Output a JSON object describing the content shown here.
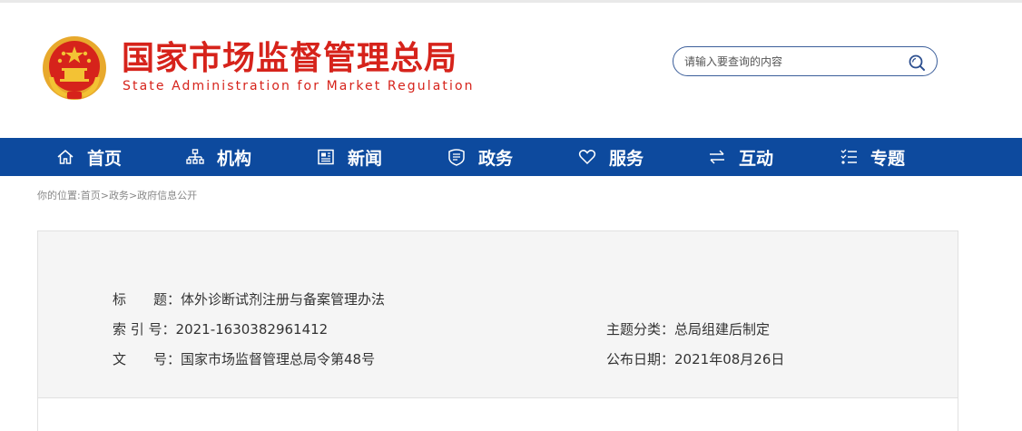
{
  "header": {
    "title_cn": "国家市场监督管理总局",
    "title_en": "State Administration for Market Regulation",
    "emblem_icon": "national-emblem-icon"
  },
  "search": {
    "placeholder": "请输入要查询的内容",
    "icon": "search-icon"
  },
  "nav": {
    "items": [
      {
        "label": "首页",
        "icon": "home-icon"
      },
      {
        "label": "机构",
        "icon": "org-chart-icon"
      },
      {
        "label": "新闻",
        "icon": "newspaper-icon"
      },
      {
        "label": "政务",
        "icon": "shield-book-icon"
      },
      {
        "label": "服务",
        "icon": "heart-icon"
      },
      {
        "label": "互动",
        "icon": "arrows-exchange-icon"
      },
      {
        "label": "专题",
        "icon": "list-icon"
      }
    ]
  },
  "breadcrumb": {
    "prefix": "你的位置:",
    "items": [
      "首页",
      "政务",
      "政府信息公开"
    ],
    "separator": ">"
  },
  "info": {
    "title_label": "标　　题：",
    "title_value": "体外诊断试剂注册与备案管理办法",
    "index_label": "索 引 号：",
    "index_value": "2021-1630382961412",
    "doc_label": "文　　号：",
    "doc_value": "国家市场监督管理总局令第48号",
    "category_label": "主题分类：",
    "category_value": "总局组建后制定",
    "date_label": "公布日期：",
    "date_value": "2021年08月26日"
  },
  "colors": {
    "brand_red": "#d6231b",
    "nav_blue": "#0d4a9e",
    "info_bg": "#f5f5f5"
  }
}
